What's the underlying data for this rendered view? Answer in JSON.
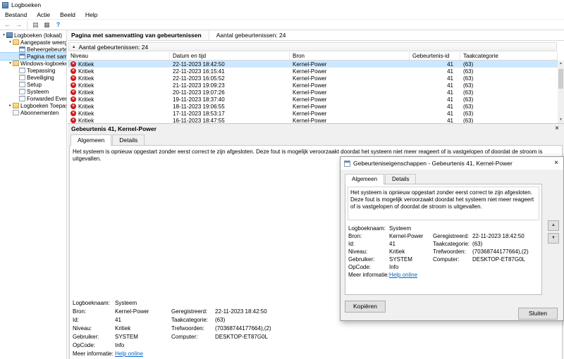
{
  "window": {
    "title": "Logboeken",
    "menu_items": [
      "Bestand",
      "Actie",
      "Beeld",
      "Help"
    ]
  },
  "toolbar": {
    "icons": [
      "back",
      "forward",
      "show-console-tree",
      "properties",
      "help"
    ]
  },
  "tree": {
    "items": [
      {
        "label": "Logboeken (lokaal)",
        "depth": 0,
        "icon": "console",
        "expander": "expanded"
      },
      {
        "label": "Aangepaste weergaven",
        "depth": 1,
        "icon": "folder",
        "expander": "expanded"
      },
      {
        "label": "Beheergebeurtenissen",
        "depth": 2,
        "icon": "view",
        "expander": "none"
      },
      {
        "label": "Pagina met samenvatting",
        "depth": 2,
        "icon": "view",
        "expander": "none",
        "selected": true
      },
      {
        "label": "Windows-logboeken",
        "depth": 1,
        "icon": "folder",
        "expander": "expanded"
      },
      {
        "label": "Toepassing",
        "depth": 2,
        "icon": "log",
        "expander": "none"
      },
      {
        "label": "Beveiliging",
        "depth": 2,
        "icon": "log",
        "expander": "none"
      },
      {
        "label": "Setup",
        "depth": 2,
        "icon": "log",
        "expander": "none"
      },
      {
        "label": "Systeem",
        "depth": 2,
        "icon": "log",
        "expander": "none"
      },
      {
        "label": "Forwarded Events",
        "depth": 2,
        "icon": "log",
        "expander": "none"
      },
      {
        "label": "Logboeken Toepassingen en",
        "depth": 1,
        "icon": "folder",
        "expander": "collapsed"
      },
      {
        "label": "Abonnementen",
        "depth": 1,
        "icon": "sub",
        "expander": "none"
      }
    ]
  },
  "summary": {
    "page_title": "Pagina met samenvatting van gebeurtenissen",
    "events_count": "Aantal gebeurtenissen: 24",
    "group_header": "Aantal gebeurtenissen: 24"
  },
  "event_table": {
    "columns": [
      "Niveau",
      "Datum en tijd",
      "Bron",
      "Gebeurtenis-id",
      "Taakcategorie"
    ],
    "rows": [
      {
        "level": "Kritiek",
        "datetime": "22-11-2023 18:42:50",
        "source": "Kernel-Power",
        "event_id": "41",
        "category": "(63)",
        "selected": true
      },
      {
        "level": "Kritiek",
        "datetime": "22-11-2023 16:15:41",
        "source": "Kernel-Power",
        "event_id": "41",
        "category": "(63)"
      },
      {
        "level": "Kritiek",
        "datetime": "22-11-2023 16:05:52",
        "source": "Kernel-Power",
        "event_id": "41",
        "category": "(63)"
      },
      {
        "level": "Kritiek",
        "datetime": "21-11-2023 19:09:23",
        "source": "Kernel-Power",
        "event_id": "41",
        "category": "(63)"
      },
      {
        "level": "Kritiek",
        "datetime": "20-11-2023 19:07:26",
        "source": "Kernel-Power",
        "event_id": "41",
        "category": "(63)"
      },
      {
        "level": "Kritiek",
        "datetime": "19-11-2023 18:37:40",
        "source": "Kernel-Power",
        "event_id": "41",
        "category": "(63)"
      },
      {
        "level": "Kritiek",
        "datetime": "18-11-2023 19:06:55",
        "source": "Kernel-Power",
        "event_id": "41",
        "category": "(63)"
      },
      {
        "level": "Kritiek",
        "datetime": "17-11-2023 18:53:17",
        "source": "Kernel-Power",
        "event_id": "41",
        "category": "(63)"
      },
      {
        "level": "Kritiek",
        "datetime": "16-11-2023 18:47:55",
        "source": "Kernel-Power",
        "event_id": "41",
        "category": "(63)"
      }
    ]
  },
  "preview": {
    "title": "Gebeurtenis 41, Kernel-Power",
    "tabs": [
      "Algemeen",
      "Details"
    ],
    "active_tab": "Algemeen"
  },
  "event_details": {
    "message": "Het systeem is opnieuw opgestart zonder eerst correct te zijn afgesloten. Deze fout is mogelijk veroorzaakt doordat het systeem niet meer reageert of is vastgelopen of doordat de stroom is uitgevallen.",
    "rows": [
      [
        {
          "label": "Logboeknaam:",
          "value": "Systeem"
        }
      ],
      [
        {
          "label": "Bron:",
          "value": "Kernel-Power"
        },
        {
          "label": "Geregistreerd:",
          "value": "22-11-2023 18:42:50"
        }
      ],
      [
        {
          "label": "Id:",
          "value": "41"
        },
        {
          "label": "Taakcategorie:",
          "value": "(63)"
        }
      ],
      [
        {
          "label": "Niveau:",
          "value": "Kritiek"
        },
        {
          "label": "Trefwoorden:",
          "value": "(70368744177664),(2)"
        }
      ],
      [
        {
          "label": "Gebruiker:",
          "value": "SYSTEM"
        },
        {
          "label": "Computer:",
          "value": "DESKTOP-ET87G0L"
        }
      ],
      [
        {
          "label": "OpCode:",
          "value": "Info"
        }
      ],
      [
        {
          "label": "Meer informatie:",
          "value": "Help online",
          "link": true
        }
      ]
    ]
  },
  "dialog": {
    "title": "Gebeurteniseigenschappen - Gebeurtenis 41, Kernel-Power",
    "tabs": [
      "Algemeen",
      "Details"
    ],
    "active_tab": "Algemeen",
    "copy_button": "Kopiëren",
    "close_button": "Sluiten"
  },
  "colors": {
    "selection": "#cce8ff",
    "critical_red": "#d11717",
    "link_blue": "#0563c1"
  }
}
